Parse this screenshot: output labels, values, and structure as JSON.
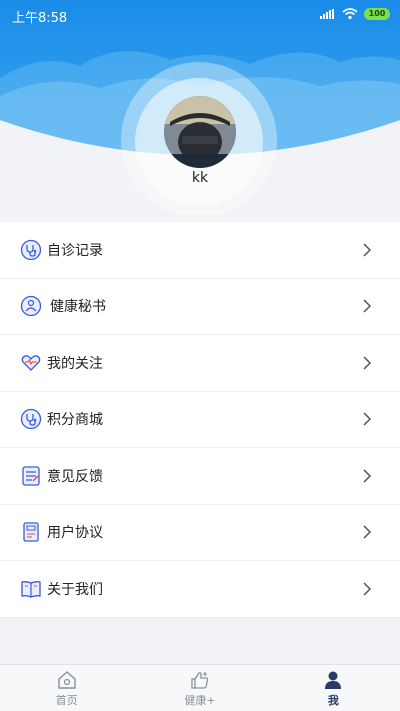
{
  "status_bar": {
    "time": "上午8:58",
    "battery": "100"
  },
  "profile": {
    "username": "kk"
  },
  "menu": {
    "items": [
      {
        "label": "自诊记录",
        "icon": "stethoscope-icon"
      },
      {
        "label": "健康秘书",
        "icon": "health-secretary-icon"
      },
      {
        "label": "我的关注",
        "icon": "heart-watch-icon"
      },
      {
        "label": "积分商城",
        "icon": "points-mall-icon"
      },
      {
        "label": "意见反馈",
        "icon": "feedback-icon"
      },
      {
        "label": "用户协议",
        "icon": "agreement-icon"
      },
      {
        "label": "关于我们",
        "icon": "book-icon"
      }
    ]
  },
  "tabbar": {
    "tabs": [
      {
        "label": "首页",
        "icon": "home-icon",
        "active": false
      },
      {
        "label": "健康+",
        "icon": "thumbs-up-icon",
        "active": false
      },
      {
        "label": "我",
        "icon": "person-icon",
        "active": true
      }
    ]
  },
  "colors": {
    "header_blue": "#1e8ee6",
    "accent": "#3a5bd9",
    "tab_active": "#2b3a67"
  }
}
